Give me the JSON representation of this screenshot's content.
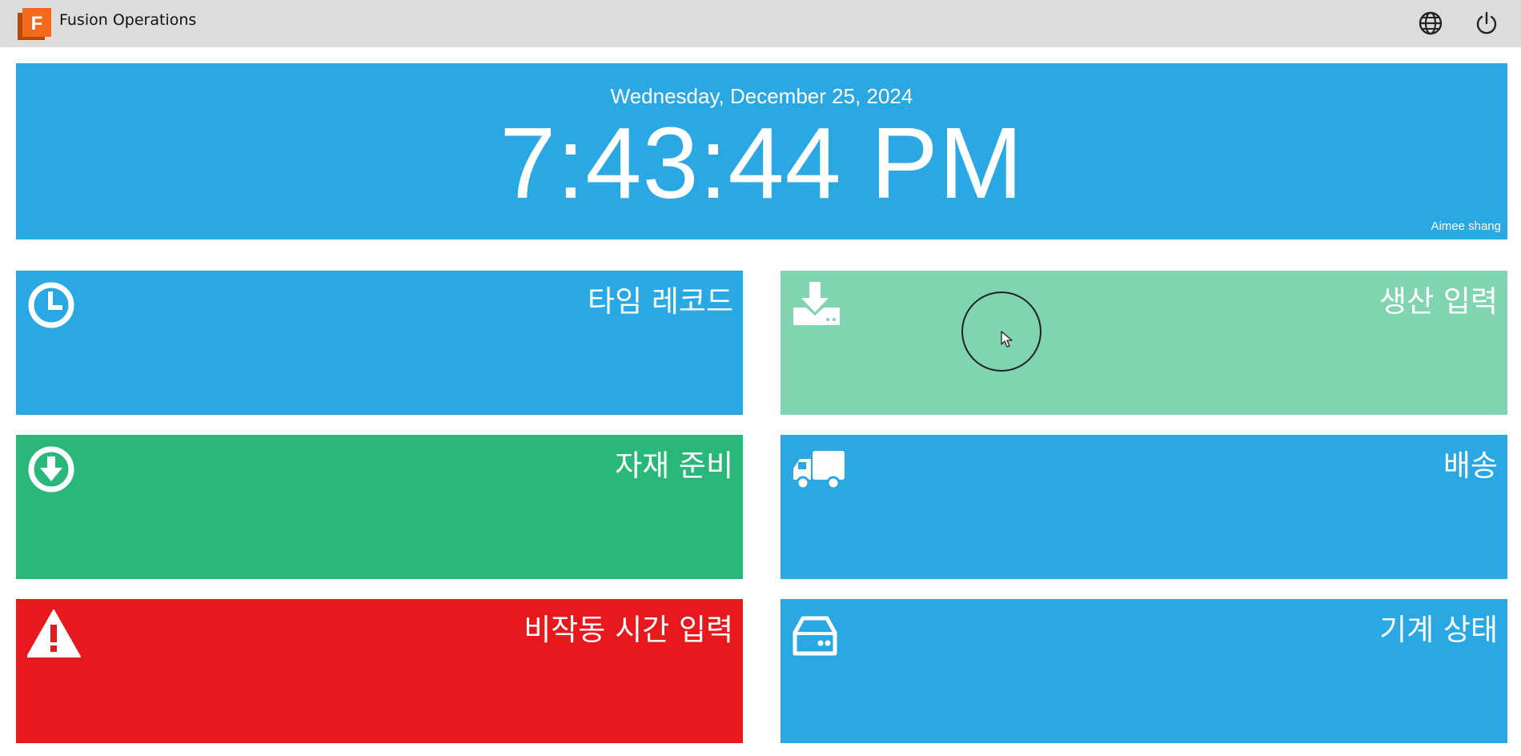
{
  "app": {
    "title": "Fusion Operations",
    "logo_letter": "F"
  },
  "header_icons": [
    "globe-icon",
    "power-icon"
  ],
  "clock": {
    "date": "Wednesday, December 25, 2024",
    "time": "7:43:44 PM",
    "user": "Aimee shang"
  },
  "tiles": [
    {
      "label": "타임 레코드",
      "icon": "clock-icon",
      "color": "#29a8e3"
    },
    {
      "label": "생산 입력",
      "icon": "download-tray-icon",
      "color": "#80d4b0"
    },
    {
      "label": "자재 준비",
      "icon": "arrow-down-circle-icon",
      "color": "#2ab87a"
    },
    {
      "label": "배송",
      "icon": "truck-icon",
      "color": "#29a8e3"
    },
    {
      "label": "비작동 시간 입력",
      "icon": "warning-icon",
      "color": "#e8191c"
    },
    {
      "label": "기계 상태",
      "icon": "hard-drive-icon",
      "color": "#29a8e3"
    }
  ],
  "colors": {
    "header_bg": "#dcdcdc",
    "clock_bg": "#29a8e3",
    "logo_orange": "#f26b1d"
  }
}
